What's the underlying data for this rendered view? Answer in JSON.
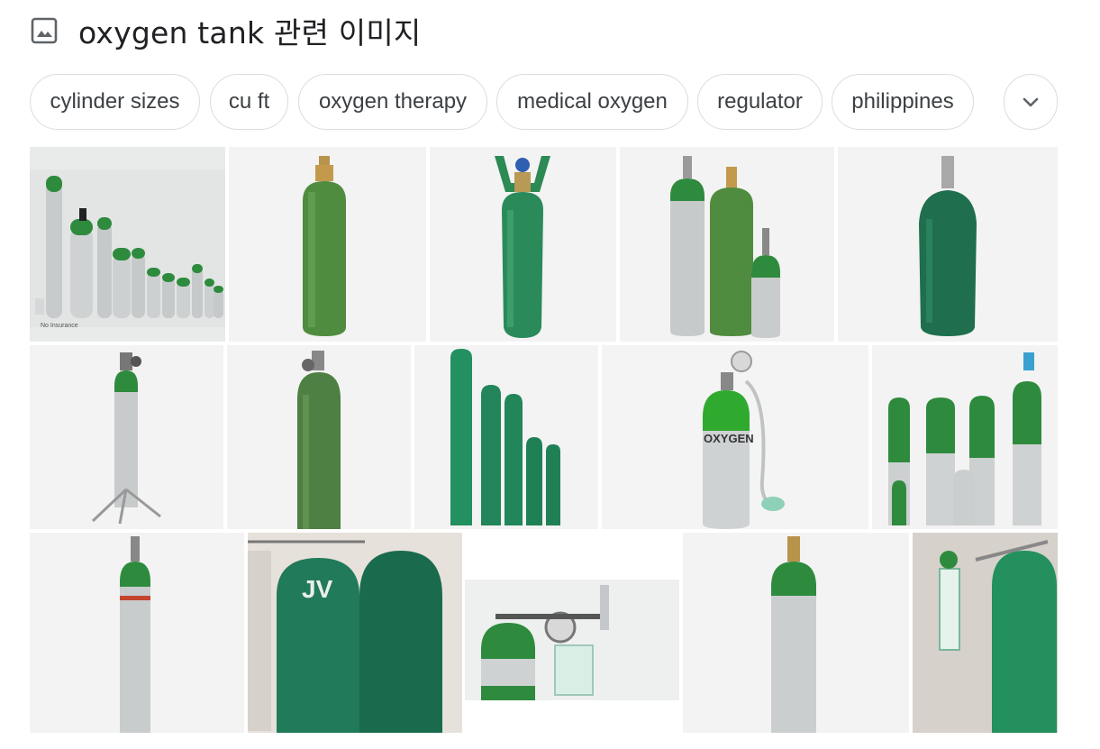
{
  "header": {
    "title": "oxygen tank 관련 이미지",
    "icon": "image-icon"
  },
  "chips": [
    {
      "label": "cylinder sizes"
    },
    {
      "label": "cu ft"
    },
    {
      "label": "oxygen therapy"
    },
    {
      "label": "medical oxygen"
    },
    {
      "label": "regulator"
    },
    {
      "label": "philippines"
    }
  ],
  "more_button": {
    "icon": "chevron-down-icon"
  },
  "images": [
    {
      "row": 1,
      "caption": "No Insurance"
    },
    {
      "row": 1
    },
    {
      "row": 1
    },
    {
      "row": 1
    },
    {
      "row": 1
    },
    {
      "row": 2
    },
    {
      "row": 2
    },
    {
      "row": 2
    },
    {
      "row": 2,
      "caption": "OXYGEN"
    },
    {
      "row": 2
    },
    {
      "row": 3
    },
    {
      "row": 3,
      "caption": "JV"
    },
    {
      "row": 3
    },
    {
      "row": 3
    },
    {
      "row": 3
    }
  ],
  "colors": {
    "chip_border": "#dadce0",
    "tank_green": "#2e8b3e",
    "tank_dark_green": "#1e6b45",
    "aluminum": "#c9ccce"
  }
}
